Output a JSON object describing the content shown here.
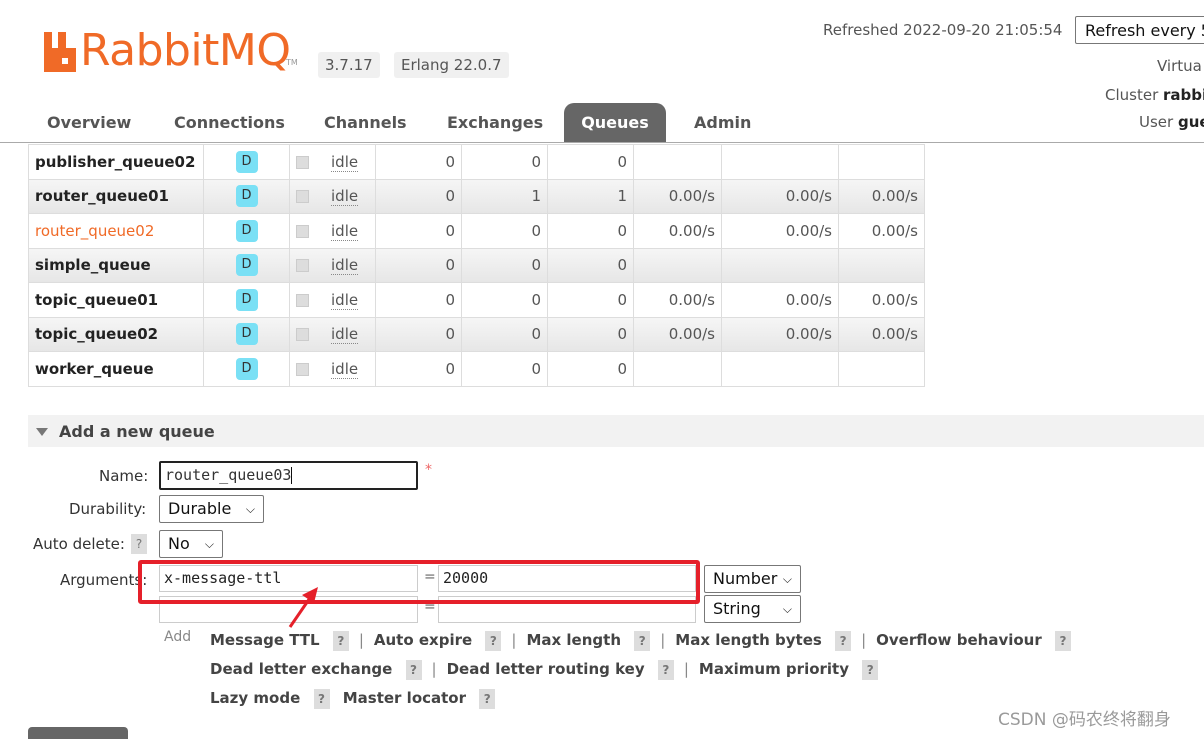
{
  "brand": {
    "name": "RabbitMQ",
    "tm": "TM",
    "version": "3.7.17",
    "erlang": "Erlang 22.0.7"
  },
  "header": {
    "refreshed": "Refreshed 2022-09-20 21:05:54",
    "refresh_select": "Refresh every 5",
    "virtual": "Virtua",
    "cluster_label": "Cluster",
    "cluster_value": "rabbi",
    "user_label": "User",
    "user_value": "gue"
  },
  "tabs": [
    "Overview",
    "Connections",
    "Channels",
    "Exchanges",
    "Queues",
    "Admin"
  ],
  "active_tab": "Queues",
  "queues": [
    {
      "name": "publisher_queue02",
      "feature": "D",
      "state": "idle",
      "ready": "0",
      "unacked": "0",
      "total": "0",
      "incoming": "",
      "deliver": "",
      "ack": "",
      "highlight": false
    },
    {
      "name": "router_queue01",
      "feature": "D",
      "state": "idle",
      "ready": "0",
      "unacked": "1",
      "total": "1",
      "incoming": "0.00/s",
      "deliver": "0.00/s",
      "ack": "0.00/s",
      "highlight": false
    },
    {
      "name": "router_queue02",
      "feature": "D",
      "state": "idle",
      "ready": "0",
      "unacked": "0",
      "total": "0",
      "incoming": "0.00/s",
      "deliver": "0.00/s",
      "ack": "0.00/s",
      "highlight": true
    },
    {
      "name": "simple_queue",
      "feature": "D",
      "state": "idle",
      "ready": "0",
      "unacked": "0",
      "total": "0",
      "incoming": "",
      "deliver": "",
      "ack": "",
      "highlight": false
    },
    {
      "name": "topic_queue01",
      "feature": "D",
      "state": "idle",
      "ready": "0",
      "unacked": "0",
      "total": "0",
      "incoming": "0.00/s",
      "deliver": "0.00/s",
      "ack": "0.00/s",
      "highlight": false
    },
    {
      "name": "topic_queue02",
      "feature": "D",
      "state": "idle",
      "ready": "0",
      "unacked": "0",
      "total": "0",
      "incoming": "0.00/s",
      "deliver": "0.00/s",
      "ack": "0.00/s",
      "highlight": false
    },
    {
      "name": "worker_queue",
      "feature": "D",
      "state": "idle",
      "ready": "0",
      "unacked": "0",
      "total": "0",
      "incoming": "",
      "deliver": "",
      "ack": "",
      "highlight": false
    }
  ],
  "add_queue": {
    "title": "Add a new queue",
    "name_label": "Name:",
    "name_value": "router_queue03",
    "required": "*",
    "durability_label": "Durability:",
    "durability_value": "Durable",
    "auto_delete_label": "Auto delete:",
    "auto_delete_value": "No",
    "help": "?",
    "arguments_label": "Arguments:",
    "arg1_key": "x-message-ttl",
    "arg1_value": "20000",
    "arg1_type": "Number",
    "arg2_key": "",
    "arg2_value": "",
    "arg2_type": "String",
    "equals": "=",
    "add_label": "Add",
    "shortcuts": [
      "Message TTL",
      "Auto expire",
      "Max length",
      "Max length bytes",
      "Overflow behaviour",
      "Dead letter exchange",
      "Dead letter routing key",
      "Maximum priority",
      "Lazy mode",
      "Master locator"
    ]
  },
  "watermark": "CSDN @码农终将翻身",
  "colors": {
    "brand_orange": "#f06a27",
    "tab_active_bg": "#666666",
    "durable_badge": "#7ae0f5",
    "annotation_red": "#e5202a"
  }
}
